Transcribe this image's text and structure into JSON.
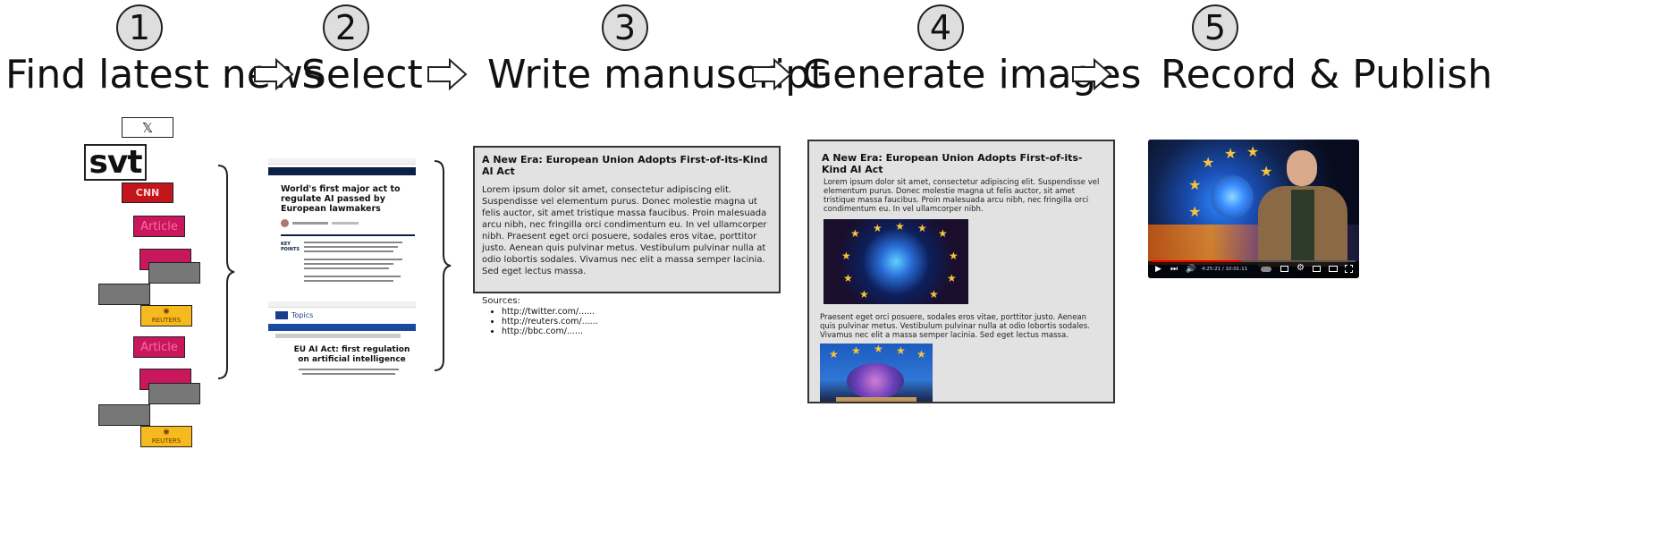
{
  "steps": [
    {
      "num": "1",
      "label": "Find latest news"
    },
    {
      "num": "2",
      "label": "Select"
    },
    {
      "num": "3",
      "label": "Write manuscript"
    },
    {
      "num": "4",
      "label": "Generate images"
    },
    {
      "num": "5",
      "label": "Record & Publish"
    }
  ],
  "sources": {
    "x_logo": "𝕏",
    "svt_logo": "svt",
    "cnn_logo": "CNN",
    "article_label": "Article",
    "reuters_label": "REUTERS"
  },
  "articles": {
    "cnn": {
      "headline": "World's first major act to regulate AI passed by European lawmakers",
      "key_points": "KEY POINTS"
    },
    "eu": {
      "section": "Topics",
      "headline": "EU AI Act: first regulation on artificial intelligence"
    }
  },
  "manuscript": {
    "title": "A New Era: European Union Adopts First-of-its-Kind AI Act",
    "body": "Lorem ipsum dolor sit amet, consectetur adipiscing elit. Suspendisse vel elementum purus. Donec molestie magna ut felis auctor, sit amet tristique massa faucibus. Proin malesuada arcu nibh, nec fringilla orci condimentum eu. In vel ullamcorper nibh. Praesent eget orci posuere, sodales eros vitae, porttitor justo. Aenean quis pulvinar metus. Vestibulum pulvinar nulla at odio lobortis sodales. Vivamus nec elit a massa semper lacinia. Sed eget lectus massa.",
    "sources_label": "Sources:",
    "sources": [
      "http://twitter.com/......",
      "http://reuters.com/......",
      "http://bbc.com/......"
    ]
  },
  "illustrated": {
    "title": "A New Era: European Union Adopts First-of-its-Kind AI Act",
    "para1": "Lorem ipsum dolor sit amet, consectetur adipiscing elit. Suspendisse vel elementum purus. Donec molestie magna ut felis auctor, sit amet tristique massa faucibus. Proin malesuada arcu nibh, nec fringilla orci condimentum eu. In vel ullamcorper nibh.",
    "para2": "Praesent eget orci posuere, sodales eros vitae, porttitor justo. Aenean quis pulvinar metus. Vestibulum pulvinar nulla at odio lobortis sodales. Vivamus nec elit a massa semper lacinia. Sed eget lectus massa."
  },
  "video": {
    "time": "4:25:21 / 10:01:11",
    "progress": 0.44
  }
}
